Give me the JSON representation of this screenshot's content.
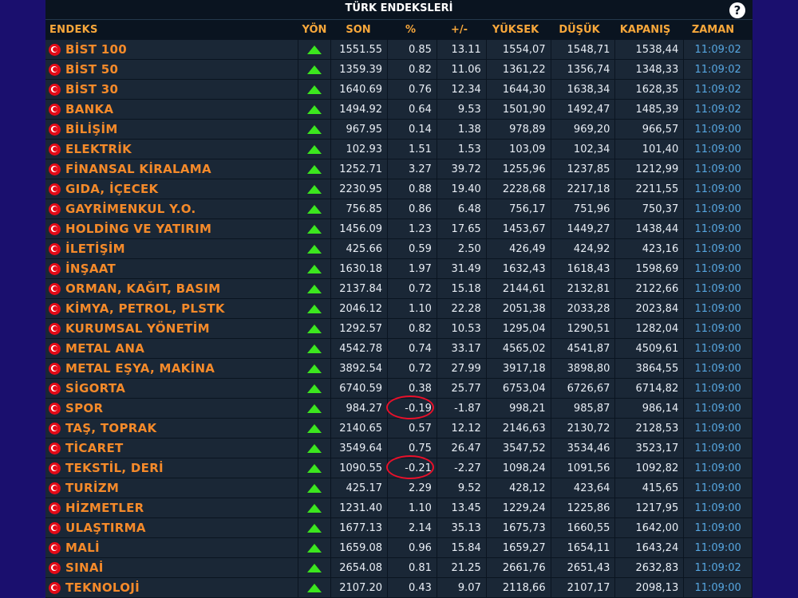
{
  "title": "TÜRK ENDEKSLERİ",
  "help_icon": "question-icon",
  "colors": {
    "header_text": "#f7a73b",
    "name_text": "#f58a2a",
    "time_text": "#56a6e0",
    "up_arrow": "#3ce61e",
    "highlight_ring": "#e8102a"
  },
  "columns": {
    "name": "ENDEKS",
    "dir": "YÖN",
    "son": "SON",
    "pct": "%",
    "chg": "+/-",
    "hi": "YÜKSEK",
    "lo": "DÜŞÜK",
    "cl": "KAPANIŞ",
    "time": "ZAMAN"
  },
  "rows": [
    {
      "name": "BİST 100",
      "son": "1551.55",
      "pct": "0.85",
      "chg": "13.11",
      "hi": "1554,07",
      "lo": "1548,71",
      "cl": "1538,44",
      "time": "11:09:02"
    },
    {
      "name": "BİST 50",
      "son": "1359.39",
      "pct": "0.82",
      "chg": "11.06",
      "hi": "1361,22",
      "lo": "1356,74",
      "cl": "1348,33",
      "time": "11:09:02"
    },
    {
      "name": "BİST 30",
      "son": "1640.69",
      "pct": "0.76",
      "chg": "12.34",
      "hi": "1644,30",
      "lo": "1638,34",
      "cl": "1628,35",
      "time": "11:09:02"
    },
    {
      "name": "BANKA",
      "son": "1494.92",
      "pct": "0.64",
      "chg": "9.53",
      "hi": "1501,90",
      "lo": "1492,47",
      "cl": "1485,39",
      "time": "11:09:02"
    },
    {
      "name": "BİLİŞİM",
      "son": "967.95",
      "pct": "0.14",
      "chg": "1.38",
      "hi": "978,89",
      "lo": "969,20",
      "cl": "966,57",
      "time": "11:09:00"
    },
    {
      "name": "ELEKTRİK",
      "son": "102.93",
      "pct": "1.51",
      "chg": "1.53",
      "hi": "103,09",
      "lo": "102,34",
      "cl": "101,40",
      "time": "11:09:00"
    },
    {
      "name": "FİNANSAL KİRALAMA",
      "son": "1252.71",
      "pct": "3.27",
      "chg": "39.72",
      "hi": "1255,96",
      "lo": "1237,85",
      "cl": "1212,99",
      "time": "11:09:00"
    },
    {
      "name": "GIDA, İÇECEK",
      "son": "2230.95",
      "pct": "0.88",
      "chg": "19.40",
      "hi": "2228,68",
      "lo": "2217,18",
      "cl": "2211,55",
      "time": "11:09:00"
    },
    {
      "name": "GAYRİMENKUL Y.O.",
      "son": "756.85",
      "pct": "0.86",
      "chg": "6.48",
      "hi": "756,17",
      "lo": "751,96",
      "cl": "750,37",
      "time": "11:09:00"
    },
    {
      "name": "HOLDİNG VE YATIRIM",
      "son": "1456.09",
      "pct": "1.23",
      "chg": "17.65",
      "hi": "1453,67",
      "lo": "1449,27",
      "cl": "1438,44",
      "time": "11:09:00"
    },
    {
      "name": "İLETİŞİM",
      "son": "425.66",
      "pct": "0.59",
      "chg": "2.50",
      "hi": "426,49",
      "lo": "424,92",
      "cl": "423,16",
      "time": "11:09:00"
    },
    {
      "name": "İNŞAAT",
      "son": "1630.18",
      "pct": "1.97",
      "chg": "31.49",
      "hi": "1632,43",
      "lo": "1618,43",
      "cl": "1598,69",
      "time": "11:09:00"
    },
    {
      "name": "ORMAN, KAĞIT, BASIM",
      "son": "2137.84",
      "pct": "0.72",
      "chg": "15.18",
      "hi": "2144,61",
      "lo": "2132,81",
      "cl": "2122,66",
      "time": "11:09:00"
    },
    {
      "name": "KİMYA, PETROL, PLSTK",
      "son": "2046.12",
      "pct": "1.10",
      "chg": "22.28",
      "hi": "2051,38",
      "lo": "2033,28",
      "cl": "2023,84",
      "time": "11:09:00"
    },
    {
      "name": "KURUMSAL YÖNETİM",
      "son": "1292.57",
      "pct": "0.82",
      "chg": "10.53",
      "hi": "1295,04",
      "lo": "1290,51",
      "cl": "1282,04",
      "time": "11:09:00"
    },
    {
      "name": "METAL ANA",
      "son": "4542.78",
      "pct": "0.74",
      "chg": "33.17",
      "hi": "4565,02",
      "lo": "4541,87",
      "cl": "4509,61",
      "time": "11:09:00"
    },
    {
      "name": "METAL EŞYA, MAKİNA",
      "son": "3892.54",
      "pct": "0.72",
      "chg": "27.99",
      "hi": "3917,18",
      "lo": "3898,80",
      "cl": "3864,55",
      "time": "11:09:00"
    },
    {
      "name": "SİGORTA",
      "son": "6740.59",
      "pct": "0.38",
      "chg": "25.77",
      "hi": "6753,04",
      "lo": "6726,67",
      "cl": "6714,82",
      "time": "11:09:00"
    },
    {
      "name": "SPOR",
      "son": "984.27",
      "pct": "-0.19",
      "chg": "-1.87",
      "hi": "998,21",
      "lo": "985,87",
      "cl": "986,14",
      "time": "11:09:00",
      "circled": true
    },
    {
      "name": "TAŞ, TOPRAK",
      "son": "2140.65",
      "pct": "0.57",
      "chg": "12.12",
      "hi": "2146,63",
      "lo": "2130,72",
      "cl": "2128,53",
      "time": "11:09:00"
    },
    {
      "name": "TİCARET",
      "son": "3549.64",
      "pct": "0.75",
      "chg": "26.47",
      "hi": "3547,52",
      "lo": "3534,46",
      "cl": "3523,17",
      "time": "11:09:00"
    },
    {
      "name": "TEKSTİL, DERİ",
      "son": "1090.55",
      "pct": "-0.21",
      "chg": "-2.27",
      "hi": "1098,24",
      "lo": "1091,56",
      "cl": "1092,82",
      "time": "11:09:00",
      "circled": true
    },
    {
      "name": "TURİZM",
      "son": "425.17",
      "pct": "2.29",
      "chg": "9.52",
      "hi": "428,12",
      "lo": "423,64",
      "cl": "415,65",
      "time": "11:09:00"
    },
    {
      "name": "HİZMETLER",
      "son": "1231.40",
      "pct": "1.10",
      "chg": "13.45",
      "hi": "1229,24",
      "lo": "1225,86",
      "cl": "1217,95",
      "time": "11:09:00"
    },
    {
      "name": "ULAŞTIRMA",
      "son": "1677.13",
      "pct": "2.14",
      "chg": "35.13",
      "hi": "1675,73",
      "lo": "1660,55",
      "cl": "1642,00",
      "time": "11:09:00"
    },
    {
      "name": "MALİ",
      "son": "1659.08",
      "pct": "0.96",
      "chg": "15.84",
      "hi": "1659,27",
      "lo": "1654,11",
      "cl": "1643,24",
      "time": "11:09:00"
    },
    {
      "name": "SINAİ",
      "son": "2654.08",
      "pct": "0.81",
      "chg": "21.25",
      "hi": "2661,76",
      "lo": "2651,43",
      "cl": "2632,83",
      "time": "11:09:02"
    },
    {
      "name": "TEKNOLOJİ",
      "son": "2107.20",
      "pct": "0.43",
      "chg": "9.07",
      "hi": "2118,66",
      "lo": "2107,17",
      "cl": "2098,13",
      "time": "11:09:00"
    }
  ]
}
